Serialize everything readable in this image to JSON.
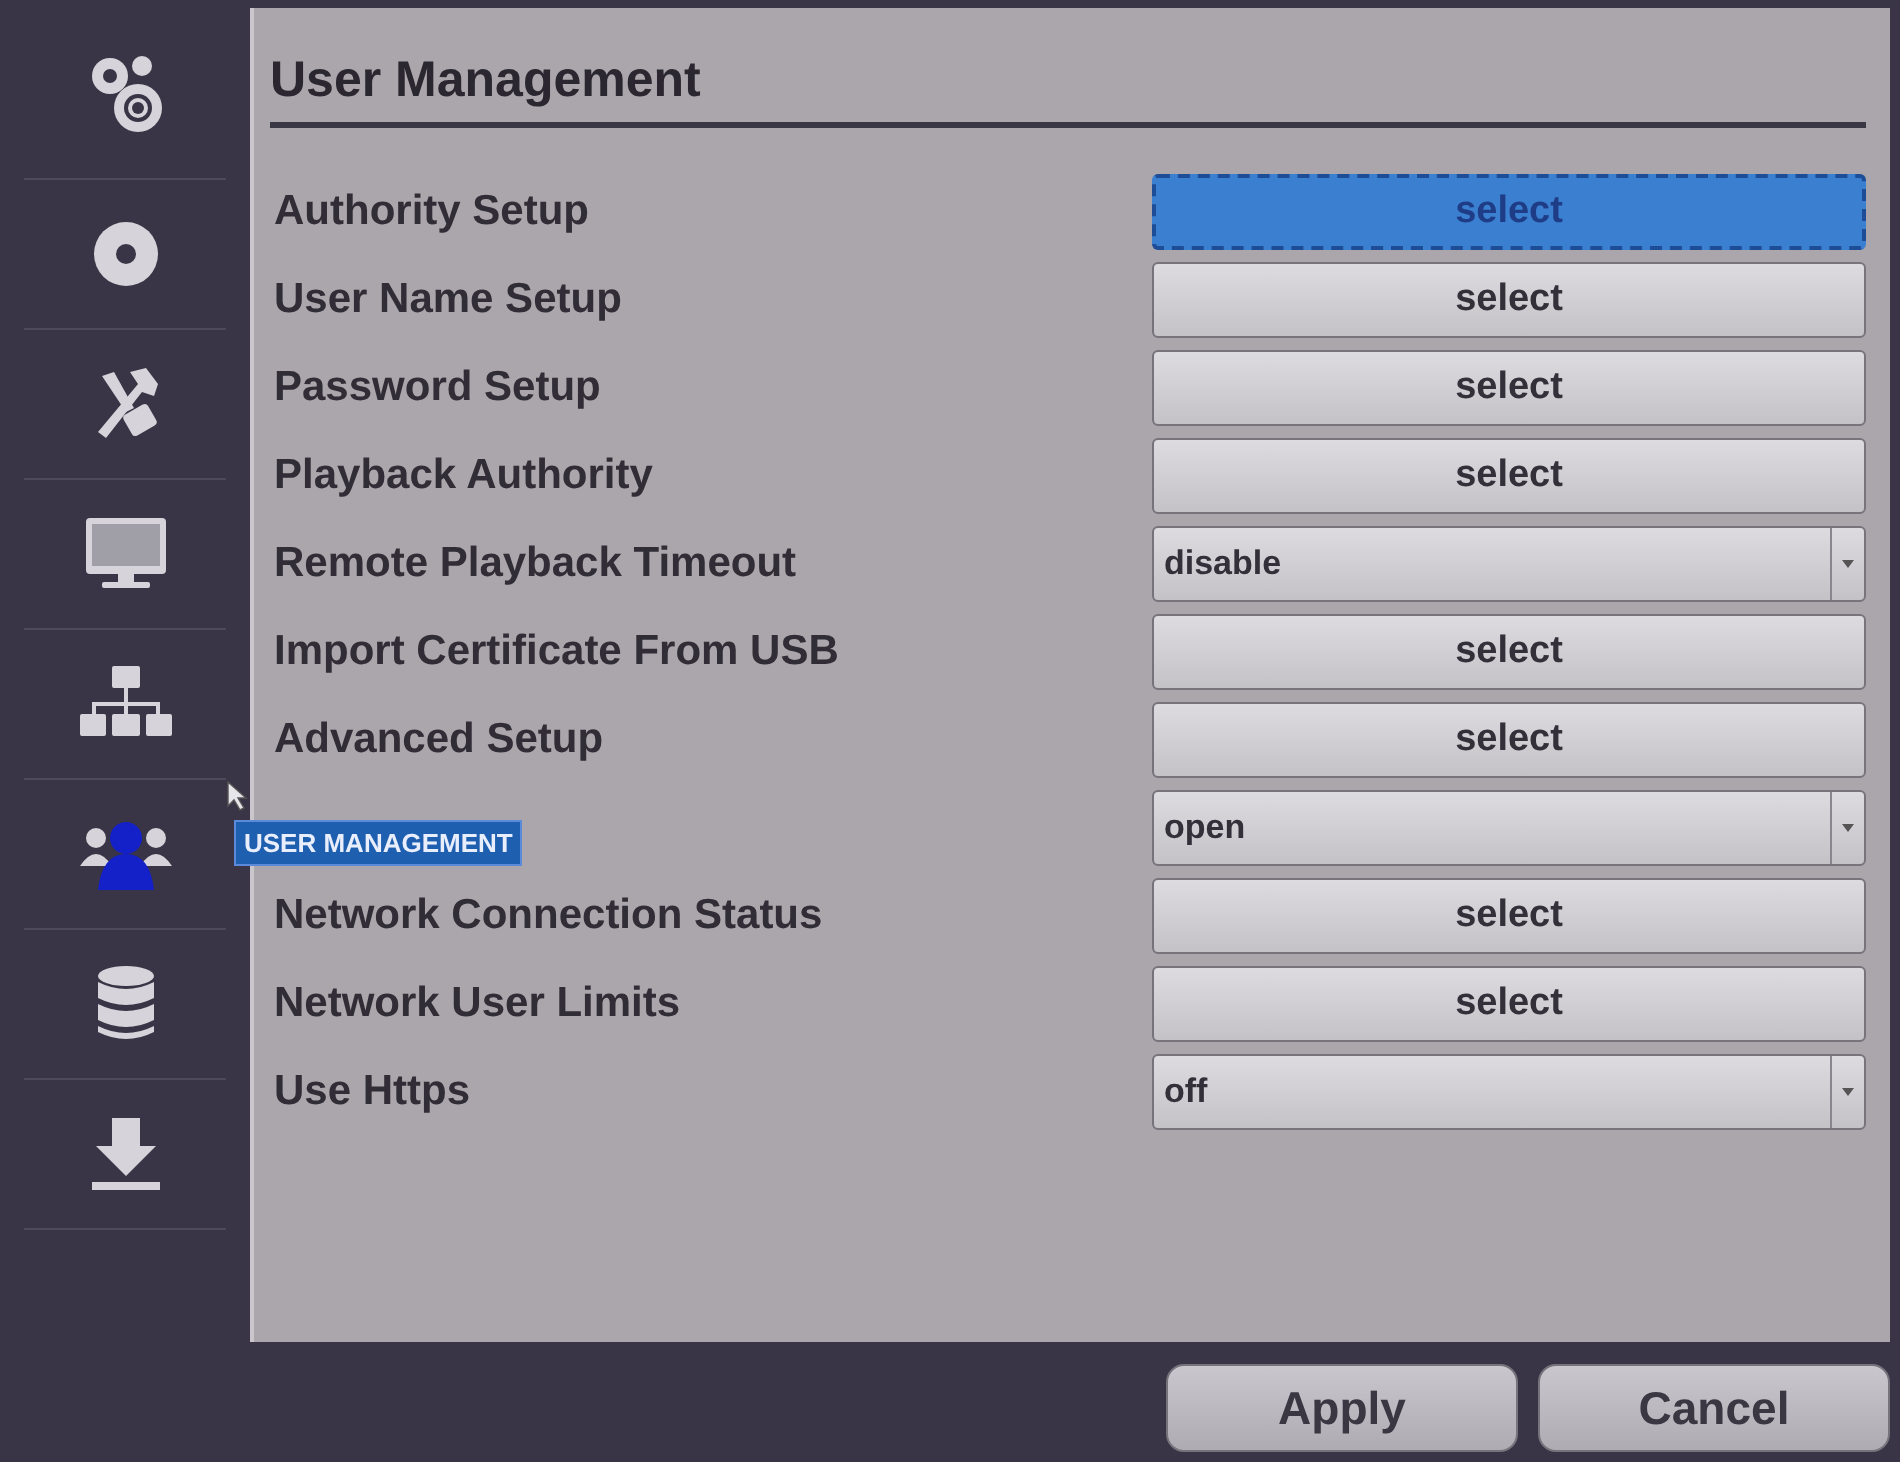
{
  "sidebar": {
    "items": [
      {
        "kind": "gears",
        "selected": false
      },
      {
        "kind": "disc",
        "selected": false
      },
      {
        "kind": "tools",
        "selected": false
      },
      {
        "kind": "monitor",
        "selected": false
      },
      {
        "kind": "network",
        "selected": false
      },
      {
        "kind": "users",
        "selected": true
      },
      {
        "kind": "database",
        "selected": false
      },
      {
        "kind": "download",
        "selected": false
      }
    ],
    "tooltip": "USER MANAGEMENT"
  },
  "panel": {
    "title": "User Management",
    "rows": [
      {
        "label": "Authority Setup",
        "kind": "button",
        "text": "select",
        "selected": true
      },
      {
        "label": "User Name Setup",
        "kind": "button",
        "text": "select",
        "selected": false
      },
      {
        "label": "Password Setup",
        "kind": "button",
        "text": "select",
        "selected": false
      },
      {
        "label": "Playback Authority",
        "kind": "button",
        "text": "select",
        "selected": false
      },
      {
        "label": "Remote Playback Timeout",
        "kind": "dropdown",
        "text": "disable",
        "selected": false
      },
      {
        "label": "Import Certificate From USB",
        "kind": "button",
        "text": "select",
        "selected": false
      },
      {
        "label": "Advanced Setup",
        "kind": "button",
        "text": "select",
        "selected": false
      },
      {
        "kind": "dropdown",
        "text": "open",
        "selected": false
      },
      {
        "label": "Network Connection Status",
        "kind": "button",
        "text": "select",
        "selected": false
      },
      {
        "label": "Network User Limits",
        "kind": "button",
        "text": "select",
        "selected": false
      },
      {
        "label": "Use Https",
        "kind": "dropdown",
        "text": "off",
        "selected": false
      }
    ]
  },
  "footer": {
    "buttons": [
      "Apply",
      "Cancel"
    ]
  }
}
